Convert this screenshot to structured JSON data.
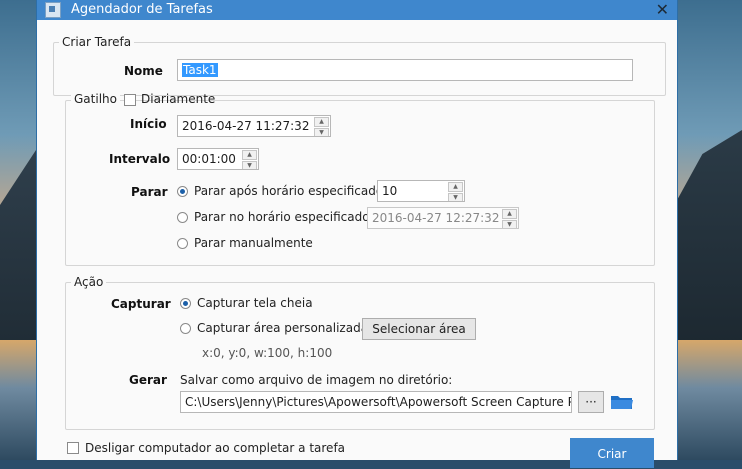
{
  "window": {
    "title": "Agendador de Tarefas",
    "close_glyph": "✕"
  },
  "task": {
    "legend": "Criar Tarefa",
    "name_label": "Nome",
    "name_value": "Task1"
  },
  "trigger": {
    "legend": "Gatilho",
    "daily_label": "Diariamente",
    "daily_checked": false,
    "start_label": "Início",
    "start_value": "2016-04-27 11:27:32",
    "interval_label": "Intervalo",
    "interval_value": "00:01:00",
    "stop_label": "Parar",
    "stop_after_label": "Parar após horário especificado:",
    "stop_after_value": "10",
    "stop_at_label": "Parar no horário especificado:",
    "stop_at_value": "2016-04-27 12:27:32",
    "stop_manual_label": "Parar manualmente",
    "selected": "stop_after"
  },
  "action": {
    "legend": "Ação",
    "capture_label": "Capturar",
    "fullscreen_label": "Capturar tela cheia",
    "custom_area_label": "Capturar área personalizada",
    "select_area_button": "Selecionar área",
    "area_info": "x:0, y:0, w:100, h:100",
    "selected": "fullscreen",
    "output_label": "Gerar",
    "save_label": "Salvar como arquivo de imagem no diretório:",
    "path_value": "C:\\Users\\Jenny\\Pictures\\Apowersoft\\Apowersoft Screen Capture Pro\\Sch",
    "browse_button": "···"
  },
  "footer": {
    "shutdown_label": "Desligar computador ao completar a tarefa",
    "shutdown_checked": false,
    "create_button": "Criar"
  },
  "colors": {
    "titlebar": "#3f87cd",
    "accent": "#3f87cd",
    "selection": "#3399ff",
    "folder": "#1f6fc5"
  }
}
